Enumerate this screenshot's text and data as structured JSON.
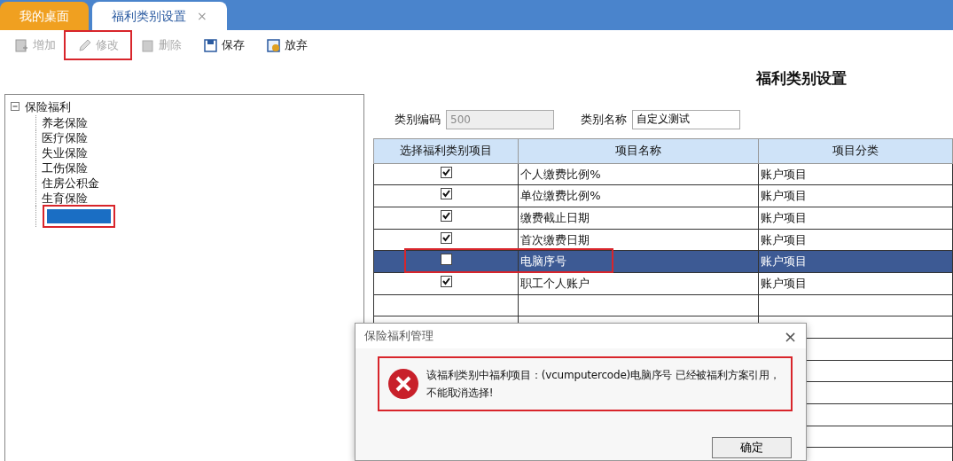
{
  "tabs": [
    {
      "label": "我的桌面",
      "selected": false,
      "closable": false
    },
    {
      "label": "福利类别设置",
      "selected": true,
      "closable": true,
      "close_label": "×"
    }
  ],
  "toolbar": [
    {
      "kind": "add",
      "label": "增加",
      "disabled": true,
      "highlighted": false
    },
    {
      "kind": "edit",
      "label": "修改",
      "disabled": true,
      "highlighted": true
    },
    {
      "kind": "delete",
      "label": "删除",
      "disabled": true,
      "highlighted": false
    },
    {
      "kind": "save",
      "label": "保存",
      "disabled": false,
      "highlighted": false
    },
    {
      "kind": "discard",
      "label": "放弃",
      "disabled": false,
      "highlighted": false
    }
  ],
  "page_title": "福利类别设置",
  "tree": {
    "label": "保险福利",
    "expanded": true,
    "children": [
      {
        "kind": "item",
        "label": "养老保险",
        "selected": false,
        "highlighted": false
      },
      {
        "kind": "item",
        "label": "医疗保险",
        "selected": false,
        "highlighted": false
      },
      {
        "kind": "item",
        "label": "失业保险",
        "selected": false,
        "highlighted": false
      },
      {
        "kind": "item",
        "label": "工伤保险",
        "selected": false,
        "highlighted": false
      },
      {
        "kind": "item",
        "label": "住房公积金",
        "selected": false,
        "highlighted": false
      },
      {
        "kind": "item",
        "label": "生育保险",
        "selected": false,
        "highlighted": false
      },
      {
        "kind": "blank",
        "selected": true,
        "highlighted": true
      }
    ]
  },
  "fields": [
    {
      "label": "类别编码",
      "value": "500",
      "disabled": true
    },
    {
      "label": "类别名称",
      "value": "自定义测试",
      "disabled": false
    }
  ],
  "table": {
    "columns": [
      "选择福利类别项目",
      "项目名称",
      "项目分类"
    ],
    "rows": [
      {
        "checked": true,
        "name": "个人缴费比例%",
        "category": "账户项目",
        "selected": false,
        "highlighted": false
      },
      {
        "checked": true,
        "name": "单位缴费比例%",
        "category": "账户项目",
        "selected": false,
        "highlighted": false
      },
      {
        "checked": true,
        "name": "缴费截止日期",
        "category": "账户项目",
        "selected": false,
        "highlighted": false
      },
      {
        "checked": true,
        "name": "首次缴费日期",
        "category": "账户项目",
        "selected": false,
        "highlighted": false
      },
      {
        "checked": false,
        "name": "电脑序号",
        "category": "账户项目",
        "selected": true,
        "highlighted": true
      },
      {
        "checked": true,
        "name": "职工个人账户",
        "category": "账户项目",
        "selected": false,
        "highlighted": false
      }
    ]
  },
  "dialog": {
    "title": "保险福利管理",
    "close": "×",
    "message": [
      "该福利类别中福利项目：(vcumputercode)电脑序号 已经被福利方案引用，",
      "不能取消选择!"
    ],
    "highlighted": true,
    "button": "确定"
  }
}
